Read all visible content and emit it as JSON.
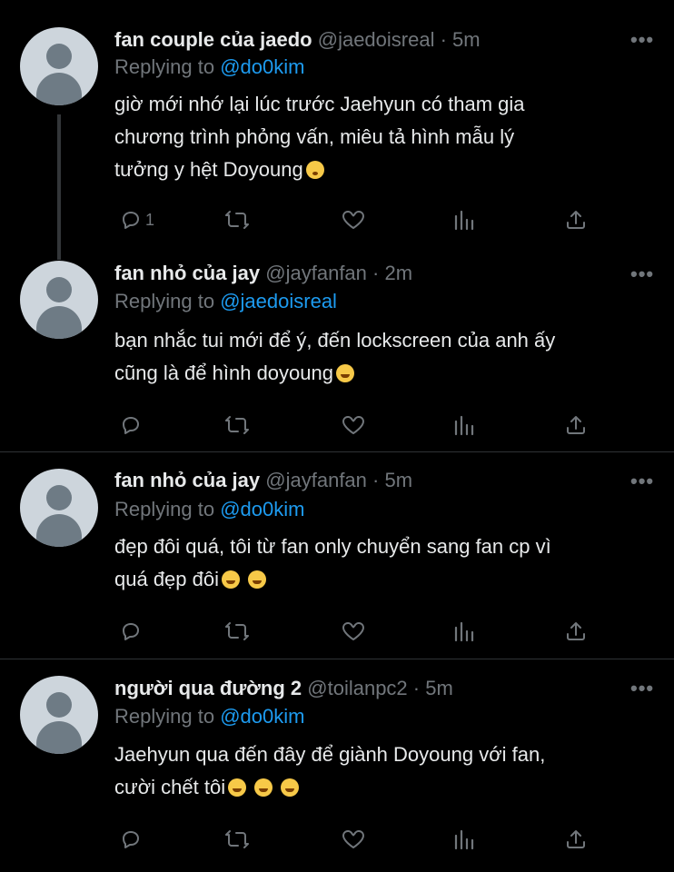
{
  "tweets": [
    {
      "name": "fan couple của jaedo",
      "handle": "@jaedoisreal",
      "time": "5m",
      "replying_prefix": "Replying to",
      "replying_handle": "@do0kim",
      "text_lines": [
        "giờ mới nhớ lại lúc trước Jaehyun có tham gia",
        "chương trình phỏng vấn, miêu tả hình mẫu lý",
        "tưởng y hệt Doyoung"
      ],
      "reply_count": "1"
    },
    {
      "name": "fan nhỏ của jay",
      "handle": "@jayfanfan",
      "time": "2m",
      "replying_prefix": "Replying to",
      "replying_handle": "@jaedoisreal",
      "text_lines": [
        "bạn nhắc tui mới để ý, đến lockscreen của anh ấy",
        "cũng là để hình doyoung"
      ],
      "reply_count": ""
    },
    {
      "name": "fan nhỏ của jay",
      "handle": "@jayfanfan",
      "time": "5m",
      "replying_prefix": "Replying to",
      "replying_handle": "@do0kim",
      "text_lines": [
        "đẹp đôi quá, tôi từ fan only chuyển sang fan cp vì",
        "quá đẹp đôi"
      ],
      "reply_count": ""
    },
    {
      "name": "người qua đường 2",
      "handle": "@toilanpc2",
      "time": "5m",
      "replying_prefix": "Replying to",
      "replying_handle": "@do0kim",
      "text_lines": [
        "Jaehyun qua đến đây để giành Doyoung với fan,",
        "cười chết tôi"
      ],
      "reply_count": ""
    }
  ],
  "separator": " · ",
  "more_glyph": "•••",
  "icons": [
    "reply-icon",
    "retweet-icon",
    "like-icon",
    "analytics-icon",
    "share-icon"
  ],
  "colors": {
    "background": "#000000",
    "text": "#e7e9ea",
    "muted": "#71767b",
    "link": "#1d9bf0",
    "divider": "#2f3336"
  }
}
